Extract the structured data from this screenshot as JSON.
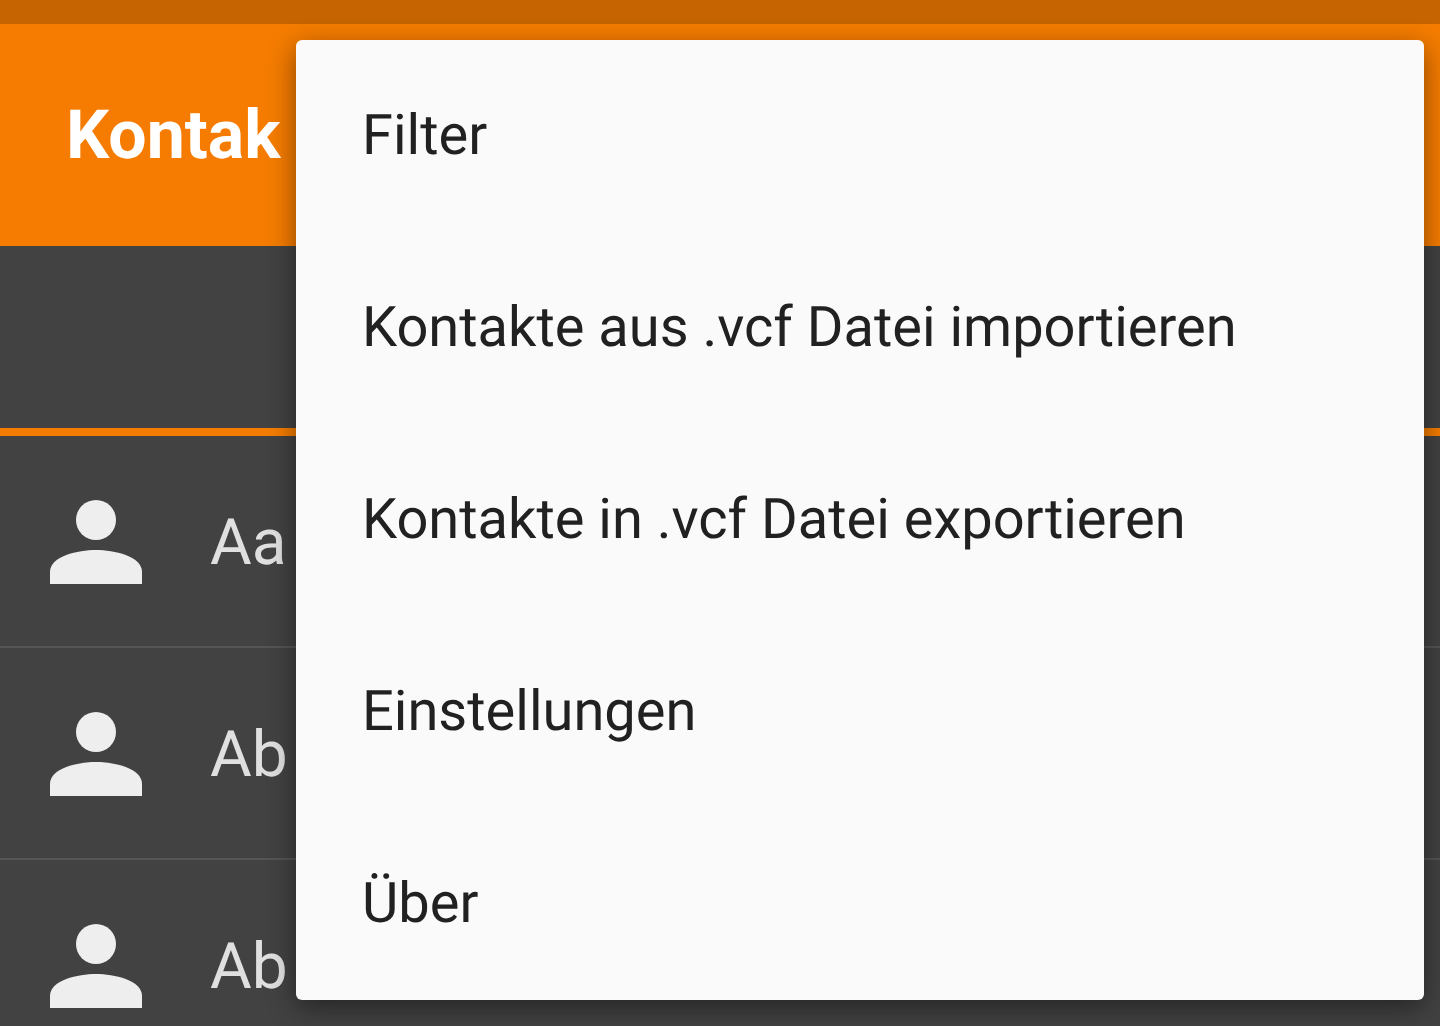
{
  "app_bar": {
    "title": "Kontak"
  },
  "contacts": [
    {
      "name": "Aa"
    },
    {
      "name": "Ab"
    },
    {
      "name": "Ab"
    }
  ],
  "menu": {
    "items": [
      {
        "label": "Filter"
      },
      {
        "label": "Kontakte aus .vcf Datei importieren"
      },
      {
        "label": "Kontakte in .vcf Datei exportieren"
      },
      {
        "label": "Einstellungen"
      },
      {
        "label": "Über"
      }
    ]
  }
}
